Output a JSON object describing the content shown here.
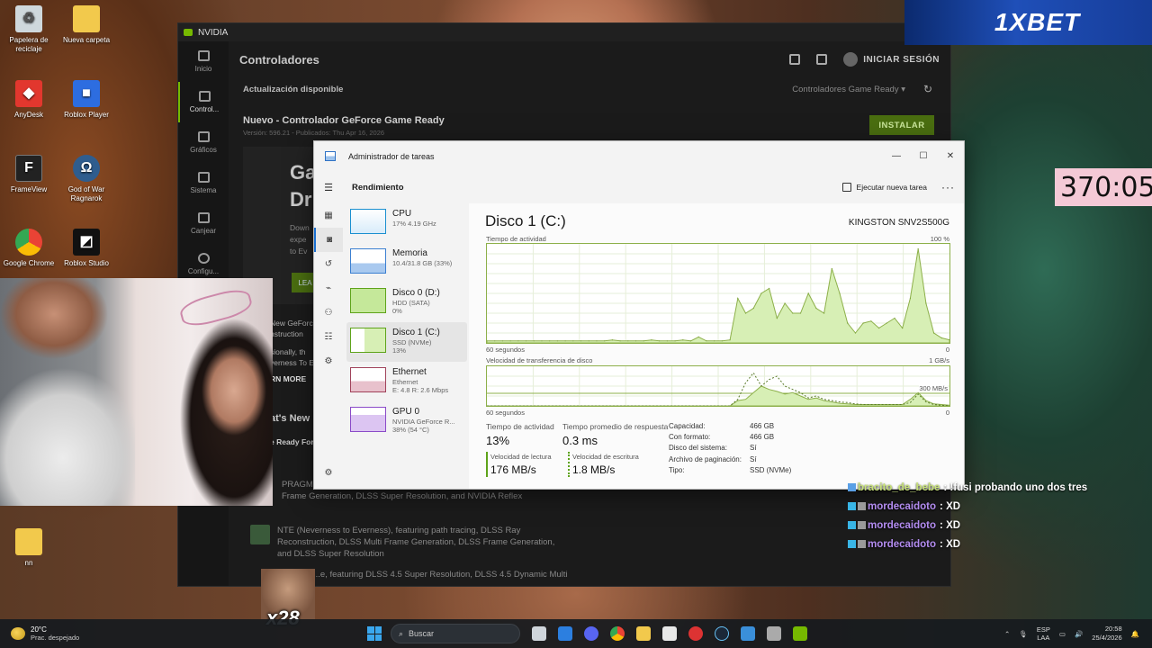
{
  "desktop_icons": [
    {
      "label": "Papelera de reciclaje",
      "icon": "recycle-bin-icon",
      "color": "#cfd8dc"
    },
    {
      "label": "Nueva carpeta",
      "icon": "folder-icon",
      "color": "#f2c94c"
    },
    {
      "label": "AnyDesk",
      "icon": "anydesk-icon",
      "color": "#e2372e"
    },
    {
      "label": "Roblox Player",
      "icon": "roblox-icon",
      "color": "#2d6de0"
    },
    {
      "label": "FrameView",
      "icon": "frameview-icon",
      "color": "#222222"
    },
    {
      "label": "God of War Ragnarok",
      "icon": "god-of-war-icon",
      "color": "#2f5d8e"
    },
    {
      "label": "Google Chrome",
      "icon": "chrome-icon",
      "color": "#4285f4"
    },
    {
      "label": "Roblox Studio",
      "icon": "roblox-studio-icon",
      "color": "#111111"
    },
    {
      "label": "nn",
      "icon": "folder-icon",
      "color": "#f2c94c"
    }
  ],
  "nvidia": {
    "window_title": "NVIDIA",
    "nav": [
      "Inicio",
      "Control...",
      "Gráficos",
      "Sistema",
      "Canjear",
      "Configu..."
    ],
    "page_title": "Controladores",
    "signin": "INICIAR SESIÓN",
    "update_available": "Actualización disponible",
    "driver_filter": "Controladores Game Ready",
    "new_driver": "Nuevo - Controlador GeForce Game Ready",
    "driver_version": "Versión: 596.21 - Publicados: Thu Apr 16, 2026",
    "install": "INSTALAR",
    "card_big": "Ga\nDr",
    "card_small": "Down\nexpe\nto Ev",
    "card_button": "LEA",
    "left_text": "New GeForce\nnstruction",
    "left_text2": "sionally, th\nverness To E",
    "learn_more": "RN MORE",
    "whats_new": "at's New",
    "ready_for": "e Ready For",
    "news": [
      "PRAGMATA, featuring path tracing, DLSS Multi Frame Generation, DLSS Frame Generation, DLSS Super Resolution, and NVIDIA Reflex",
      "NTE (Neverness to Everness), featuring path tracing, DLSS Ray Reconstruction, DLSS Multi Frame Generation, DLSS Frame Generation, and DLSS Super Resolution",
      "...e, featuring DLSS 4.5 Super Resolution, DLSS 4.5 Dynamic Multi"
    ]
  },
  "task_manager": {
    "window_title": "Administrador de tareas",
    "section": "Rendimiento",
    "run_task": "Ejecutar nueva tarea",
    "more": "···",
    "list": [
      {
        "name": "CPU",
        "sub1": "17% 4.19 GHz",
        "sub2": "",
        "color": "#1a8fd0"
      },
      {
        "name": "Memoria",
        "sub1": "10.4/31.8 GB (33%)",
        "sub2": "",
        "color": "#3b7fd1"
      },
      {
        "name": "Disco 0 (D:)",
        "sub1": "HDD (SATA)",
        "sub2": "0%",
        "color": "#5ea31a"
      },
      {
        "name": "Disco 1 (C:)",
        "sub1": "SSD (NVMe)",
        "sub2": "13%",
        "color": "#5ea31a"
      },
      {
        "name": "Ethernet",
        "sub1": "Ethernet",
        "sub2": "E: 4.8  R: 2.6 Mbps",
        "color": "#a0425a"
      },
      {
        "name": "GPU 0",
        "sub1": "NVIDIA GeForce R...",
        "sub2": "38% (54 °C)",
        "color": "#8a4ac8"
      }
    ],
    "disk_title": "Disco 1 (C:)",
    "disk_model": "KINGSTON SNV2S500G",
    "activity_label": "Tiempo de actividad",
    "activity_max": "100 %",
    "axis_left": "60 segundos",
    "axis_right": "0",
    "transfer_label": "Velocidad de transferencia de disco",
    "transfer_max": "1 GB/s",
    "transfer_mid": "300 MB/s",
    "stats": {
      "activity_time_label": "Tiempo de actividad",
      "activity_time": "13%",
      "avg_response_label": "Tiempo promedio de respuesta",
      "avg_response": "0.3 ms",
      "read_label": "Velocidad de lectura",
      "read": "176 MB/s",
      "write_label": "Velocidad de escritura",
      "write": "1.8 MB/s"
    },
    "props": [
      {
        "k": "Capacidad:",
        "v": "466 GB"
      },
      {
        "k": "Con formato:",
        "v": "466 GB"
      },
      {
        "k": "Disco del sistema:",
        "v": "Sí"
      },
      {
        "k": "Archivo de paginación:",
        "v": "Sí"
      },
      {
        "k": "Tipo:",
        "v": "SSD (NVMe)"
      }
    ],
    "chart_data": {
      "type": "area",
      "activity_series": [
        2,
        2,
        2,
        2,
        2,
        2,
        2,
        2,
        2,
        2,
        2,
        2,
        2,
        2,
        2,
        2,
        3,
        2,
        2,
        2,
        2,
        3,
        2,
        2,
        2,
        3,
        2,
        6,
        2,
        2,
        2,
        3,
        45,
        30,
        35,
        50,
        55,
        25,
        40,
        30,
        30,
        50,
        35,
        30,
        75,
        50,
        20,
        10,
        20,
        22,
        15,
        20,
        25,
        15,
        45,
        95,
        40,
        10,
        5,
        3
      ],
      "read_series": [
        0,
        0,
        0,
        0,
        0,
        0,
        0,
        0,
        0,
        0,
        0,
        0,
        0,
        0,
        0,
        0,
        0,
        0,
        0,
        0,
        0,
        0,
        0,
        0,
        0,
        0,
        0,
        0,
        0,
        0,
        0,
        0,
        8,
        10,
        20,
        30,
        25,
        22,
        18,
        20,
        15,
        10,
        12,
        8,
        6,
        4,
        3,
        2,
        2,
        2,
        2,
        2,
        2,
        2,
        10,
        20,
        8,
        3,
        2,
        1
      ],
      "write_series": [
        0,
        0,
        0,
        0,
        0,
        0,
        0,
        0,
        0,
        0,
        0,
        0,
        0,
        0,
        0,
        0,
        0,
        0,
        0,
        0,
        0,
        0,
        0,
        0,
        0,
        0,
        0,
        0,
        0,
        0,
        0,
        0,
        10,
        35,
        50,
        30,
        40,
        45,
        30,
        25,
        20,
        12,
        15,
        10,
        8,
        6,
        5,
        3,
        2,
        2,
        2,
        2,
        2,
        2,
        5,
        18,
        6,
        2,
        1,
        0
      ]
    }
  },
  "overlays": {
    "bet_brand": "1XBET",
    "timer": "370:05",
    "x28": "x28",
    "chat": [
      {
        "user": "bracito_de_bebe",
        "msg": ": !fusi probando uno dos tres",
        "color": "#c8e27a"
      },
      {
        "user": "mordecaidoto",
        "msg": ": XD",
        "color": "#b38cf0"
      },
      {
        "user": "mordecaidoto",
        "msg": ": XD",
        "color": "#b38cf0"
      },
      {
        "user": "mordecaidoto",
        "msg": ": XD",
        "color": "#b38cf0"
      }
    ]
  },
  "taskbar": {
    "temp": "20°C",
    "weather": "Prac. despejado",
    "search_placeholder": "Buscar",
    "lang": "ESP",
    "region": "LAA",
    "time": "20:58",
    "date": "25/4/2026",
    "apps": [
      "task-view-icon",
      "outlook-icon",
      "discord-icon",
      "chrome-icon",
      "file-explorer-icon",
      "store-icon",
      "app-icon",
      "steam-icon",
      "task-manager-icon",
      "game-icon",
      "nvidia-icon"
    ]
  }
}
